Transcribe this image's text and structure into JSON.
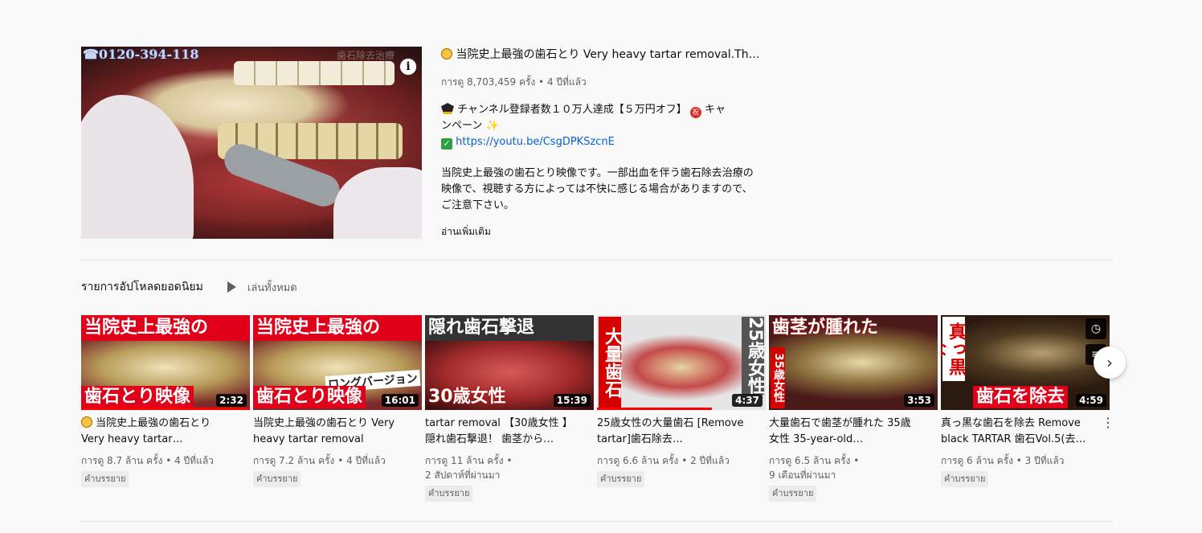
{
  "featured": {
    "phone": "☎0120-394-118",
    "watermark": "歯石除去治療",
    "title": "当院史上最強の歯石とり Very heavy tartar removal.Thi…",
    "meta": "การดู 8,703,459 ครั้ง • 4 ปีที่แล้ว",
    "desc_line1": "チャンネル登録者数１０万人達成【５万円オフ】",
    "desc_line1b": "キャ",
    "desc_line2": "ンペーン",
    "link": "https://youtu.be/CsgDPKSzcnE",
    "desc_para": "当院史上最強の歯石とり映像です。一部出血を伴う歯石除去治療の映像で、視聴する方によっては不快に感じる場合がありますので、ご注意下さい。",
    "read_more": "อ่านเพิ่มเติม"
  },
  "shelf": {
    "title": "รายการอัปโหลดยอดนิยม",
    "play_all": "เล่นทั้งหมด"
  },
  "cards": [
    {
      "cap_top": "当院史上最強の",
      "cap_bot": "歯石とり映像",
      "duration": "2:32",
      "title": "当院史上最強の歯石とり Very heavy tartar…",
      "meta1": "การดู 8.7 ล้าน ครั้ง • 4 ปีที่แล้ว",
      "meta2": "",
      "tag": "คำบรรยาย",
      "progress": 1.0
    },
    {
      "cap_top": "当院史上最強の",
      "cap_bot": "歯石とり映像",
      "cap_mid": "ロングバージョン",
      "duration": "16:01",
      "title": "当院史上最強の歯石とり Very heavy tartar removal [Long…",
      "meta1": "การดู 7.2 ล้าน ครั้ง • 4 ปีที่แล้ว",
      "meta2": "",
      "tag": "คำบรรยาย",
      "progress": 0
    },
    {
      "cap_top": "隠れ歯石撃退",
      "cap_bot": "30歳女性",
      "duration": "15:39",
      "title": "tartar removal 【30歳女性 】隠れ歯石撃退！ 歯茎から…",
      "meta1": "การดู 11 ล้าน ครั้ง •",
      "meta2": "2 สัปดาห์ที่ผ่านมา",
      "tag": "คำบรรยาย",
      "progress": 0
    },
    {
      "cap_left": "大量歯石",
      "cap_right": "25歳女性",
      "duration": "4:37",
      "title": "25歳女性の大量歯石 [Remove tartar]歯石除去…",
      "meta1": "การดู 6.6 ล้าน ครั้ง • 2 ปีที่แล้ว",
      "meta2": "",
      "tag": "คำบรรยาย",
      "progress": 0.68
    },
    {
      "cap_top": "歯茎が腫れた",
      "cap_side": "35歳女性",
      "duration": "3:53",
      "title": "大量歯石で歯茎が腫れた 35歳女性 35-year-old…",
      "meta1": "การดู 6.5 ล้าน ครั้ง •",
      "meta2": "9 เดือนที่ผ่านมา",
      "tag": "คำบรรยาย",
      "progress": 0
    },
    {
      "cap_left": "真っ黒な",
      "cap_bot": "歯石を除去",
      "duration": "4:59",
      "title": "真っ黒な歯石を除去 Remove black TARTAR 歯石Vol.5(去…",
      "meta1": "การดู 6 ล้าน ครั้ง • 3 ปีที่แล้ว",
      "meta2": "",
      "tag": "คำบรรยาย",
      "progress": 0
    }
  ]
}
